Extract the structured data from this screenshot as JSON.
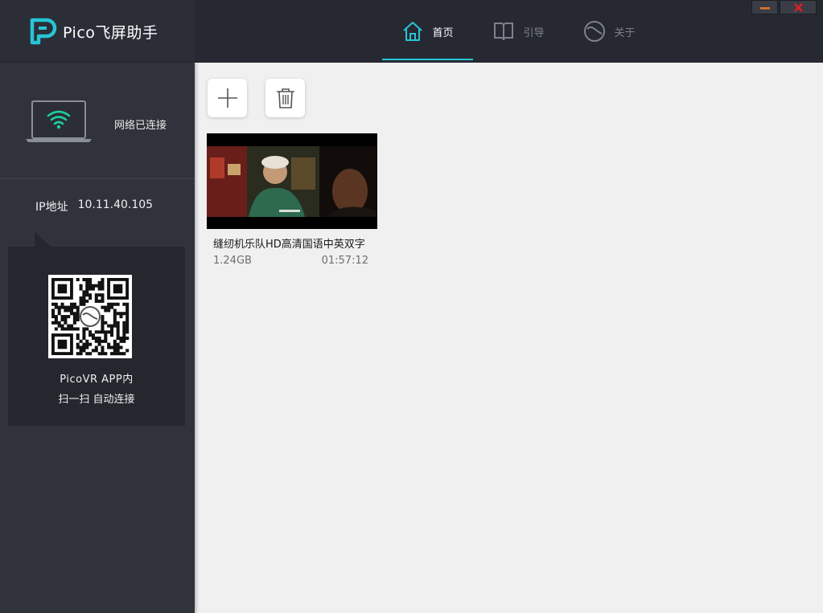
{
  "app": {
    "title": "Pico飞屏助手"
  },
  "nav": {
    "items": [
      {
        "label": "首页",
        "icon": "home-icon",
        "active": true
      },
      {
        "label": "引导",
        "icon": "book-icon",
        "active": false
      },
      {
        "label": "关于",
        "icon": "pico-circle-icon",
        "active": false
      }
    ]
  },
  "window": {
    "minimize_icon": "minimize-icon",
    "close_icon": "close-icon"
  },
  "sidebar": {
    "network_status": "网络已连接",
    "ip_label": "IP地址",
    "ip_value": "10.11.40.105",
    "qr_line1": "PicoVR APP内",
    "qr_line2": "扫一扫 自动连接"
  },
  "toolbar": {
    "add_icon": "plus-icon",
    "delete_icon": "trash-icon"
  },
  "videos": [
    {
      "title": "缝纫机乐队HD高清国语中英双字",
      "size": "1.24GB",
      "duration": "01:57:12"
    }
  ],
  "colors": {
    "accent": "#27c4d4",
    "topbar": "#262932",
    "sidebar": "#30333c",
    "minimize": "#e8742a",
    "close": "#e02020"
  }
}
